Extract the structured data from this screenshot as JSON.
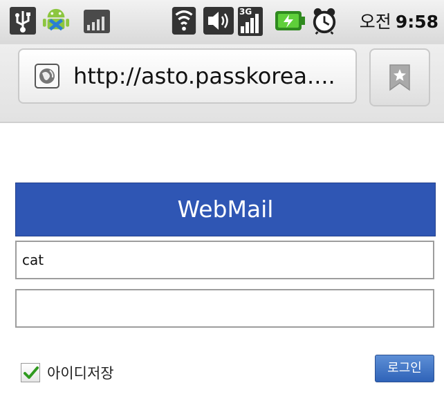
{
  "status_bar": {
    "icons": [
      "usb-icon",
      "android-debug-icon",
      "sd-card-icon",
      "wifi-icon",
      "volume-icon",
      "3g-signal-icon",
      "battery-charging-icon",
      "alarm-clock-icon"
    ],
    "network_label": "3G",
    "ampm": "오전",
    "time": "9:58"
  },
  "browser": {
    "url": "http://asto.passkorea....",
    "icons": [
      "globe-icon",
      "bookmark-icon"
    ]
  },
  "login": {
    "title": "WebMail",
    "id_value": "cat",
    "password_value": "",
    "remember_label": "아이디저장",
    "remember_checked": true,
    "login_button": "로그인",
    "accent_color": "#2f56b4"
  }
}
